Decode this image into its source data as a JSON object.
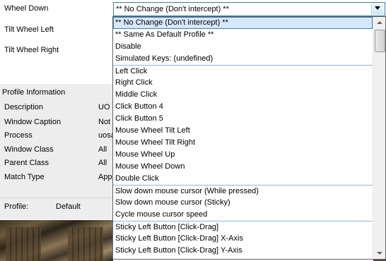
{
  "left": {
    "wheel_down_label": "Wheel Down",
    "tilt_left_label": "Tilt Wheel Left",
    "tilt_right_label": "Tilt Wheel Right"
  },
  "info": {
    "heading": "Profile Information",
    "rows": [
      {
        "label": "Description",
        "value": "UO"
      },
      {
        "label": "Window Caption",
        "value": "Not I"
      },
      {
        "label": "Process",
        "value": "uosa"
      },
      {
        "label": "Window Class",
        "value": "All"
      },
      {
        "label": "Parent Class",
        "value": "All"
      },
      {
        "label": "Match Type",
        "value": "Appl"
      }
    ],
    "profile_label": "Profile:",
    "profile_value": "Default"
  },
  "combo": {
    "selected": "** No Change (Don't intercept) **"
  },
  "dropdown": {
    "items": [
      "** No Change (Don't intercept) **",
      "** Same As Default Profile **",
      "Disable",
      "Simulated Keys: (undefined)",
      "Left Click",
      "Right Click",
      "Middle Click",
      "Click Button 4",
      "Click Button 5",
      "Mouse Wheel Tilt Left",
      "Mouse Wheel Tilt Right",
      "Mouse Wheel Up",
      "Mouse Wheel Down",
      "Double Click",
      "Slow down mouse cursor (While pressed)",
      "Slow down mouse cursor (Sticky)",
      "Cycle mouse cursor speed",
      "Sticky Left Button [Click-Drag]",
      "Sticky Left Button [Click-Drag] X-Axis",
      "Sticky Left Button [Click-Drag] Y-Axis"
    ]
  },
  "icons": {
    "dropdown_arrow": "chevron-down-icon",
    "scroll_up": "scroll-up-arrow-icon",
    "scroll_down": "scroll-down-arrow-icon"
  },
  "colors": {
    "selection": "#d7e8fb",
    "focus_border": "#3c7fb1",
    "panel_bg": "#ededed"
  }
}
